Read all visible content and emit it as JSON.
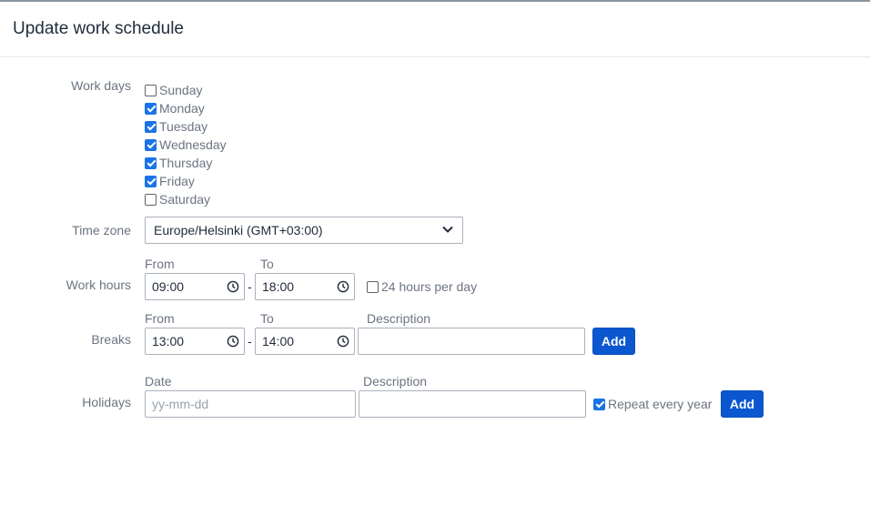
{
  "header": {
    "title": "Update work schedule"
  },
  "work_days": {
    "label": "Work days",
    "days": [
      {
        "label": "Sunday",
        "checked": false
      },
      {
        "label": "Monday",
        "checked": true
      },
      {
        "label": "Tuesday",
        "checked": true
      },
      {
        "label": "Wednesday",
        "checked": true
      },
      {
        "label": "Thursday",
        "checked": true
      },
      {
        "label": "Friday",
        "checked": true
      },
      {
        "label": "Saturday",
        "checked": false
      }
    ]
  },
  "time_zone": {
    "label": "Time zone",
    "value": "Europe/Helsinki (GMT+03:00)",
    "icon": "chevron-down-icon"
  },
  "work_hours": {
    "label": "Work hours",
    "from_label": "From",
    "to_label": "To",
    "from_value": "09:00",
    "to_value": "18:00",
    "separator": "-",
    "all_day_label": "24 hours per day",
    "all_day_checked": false
  },
  "breaks": {
    "label": "Breaks",
    "from_label": "From",
    "to_label": "To",
    "description_label": "Description",
    "from_value": "13:00",
    "to_value": "14:00",
    "separator": "-",
    "description_value": "",
    "add_label": "Add"
  },
  "holidays": {
    "label": "Holidays",
    "date_label": "Date",
    "description_label": "Description",
    "date_placeholder": "yy-mm-dd",
    "description_value": "",
    "repeat_label": "Repeat every year",
    "repeat_checked": true,
    "add_label": "Add"
  },
  "colors": {
    "accent": "#0b57d0",
    "checkbox": "#1a73e8"
  }
}
